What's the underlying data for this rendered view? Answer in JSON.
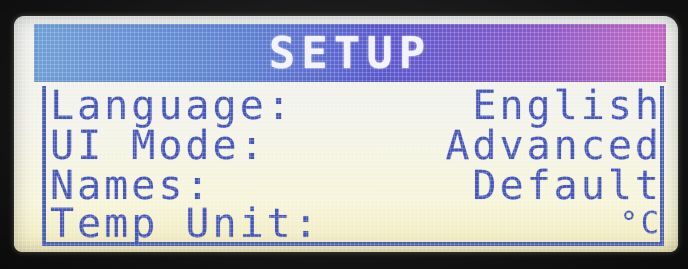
{
  "screen": {
    "title": "SETUP",
    "accent_color": "#4556b8",
    "title_bar_colors": [
      "#6f9fd6",
      "#5a58cc",
      "#c46ac4"
    ]
  },
  "settings": [
    {
      "label": "Language:",
      "value": "English"
    },
    {
      "label": "UI Mode:",
      "value": "Advanced"
    },
    {
      "label": "Names:",
      "value": "Default"
    },
    {
      "label": "Temp Unit:",
      "value": "°C"
    }
  ]
}
